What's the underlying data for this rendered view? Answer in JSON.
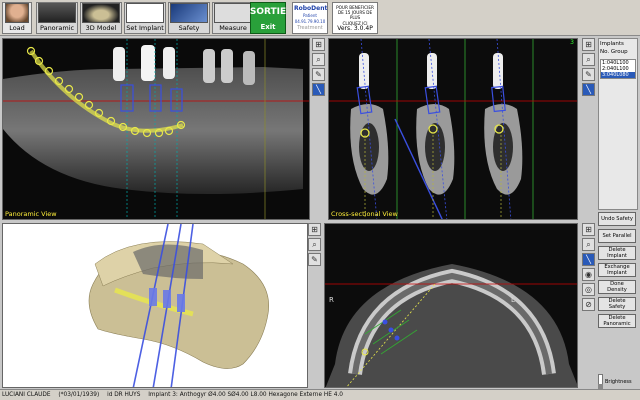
{
  "toolbar": {
    "load_label": "Load",
    "panoramic_label": "Panoramic",
    "model3d_label": "3D Model",
    "set_implant_label": "Set Implant",
    "safety_label": "Safety",
    "measure_label": "Measure",
    "exit_top": "SORTIE",
    "exit_label": "Exit",
    "robodent_name": "RoboDent",
    "robodent_sub": "Patient",
    "robodent_phone": "04.91.79.90.10",
    "robodent_mode": "Treatment",
    "info_line1": "POUR BENEFICIER",
    "info_line2": "DE 15 JOURS DE PLUS",
    "info_line3": "CLIQUEZ ICI",
    "version": "Vers. 3.0.4P"
  },
  "viewports": {
    "panoramic_label": "Panoramic View",
    "cross_label": "Cross-sectional View",
    "cross_index": "3",
    "axial_right": "R",
    "axial_left": "L"
  },
  "implants": {
    "title": "Implants",
    "col_no": "No.",
    "col_group": "Group",
    "items": [
      "1:040L100",
      "2:040L100",
      "3:040L080"
    ],
    "selected_index": 2
  },
  "actions": {
    "undo_safety": "Undo Safety",
    "set_parallel": "Set Parallel",
    "delete_implant": "Delete Implant",
    "exchange_implant": "Exchange Implant",
    "done_density": "Done Density",
    "delete_safety": "Delete Safety",
    "delete_panoramic": "Delete Panoramic",
    "brightness": "Brightness"
  },
  "status": {
    "patient": "LUCIANI CLAUDE",
    "dob": "(*03/01/1939)",
    "doctor": "id DR HUYS",
    "implant_info": "Implant 3: Anthogyr Ø4.00 SØ4.00 L8.00 Hexagone Externe HE 4.0"
  },
  "colors": {
    "accent_blue": "#2a5ab8",
    "exit_green": "#29a03a",
    "label_yellow": "#ffef3a",
    "nerve_yellow": "#e8e84a",
    "implant_blue": "#3a4fe0"
  }
}
